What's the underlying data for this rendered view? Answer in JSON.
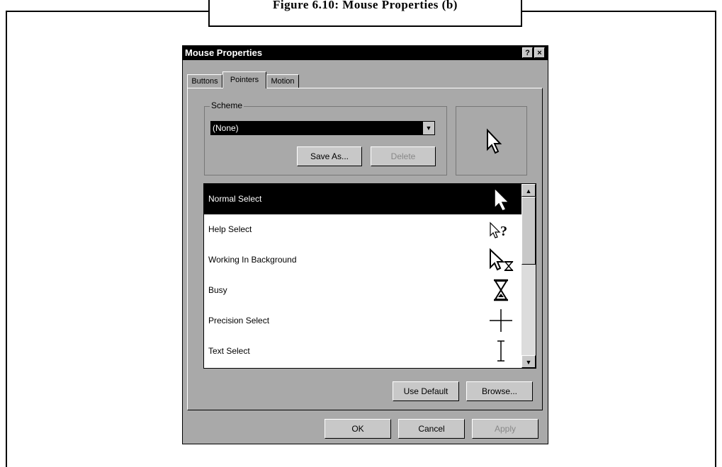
{
  "figure": {
    "caption": "Figure 6.10: Mouse Properties (b)"
  },
  "dialog": {
    "title": "Mouse Properties",
    "help_btn": "?",
    "close_btn": "×",
    "tabs": [
      {
        "label": "Buttons"
      },
      {
        "label": "Pointers"
      },
      {
        "label": "Motion"
      }
    ],
    "scheme": {
      "label": "Scheme",
      "selected": "(None)",
      "save_as": "Save As...",
      "delete": "Delete"
    },
    "pointers": [
      {
        "label": "Normal Select",
        "icon": "arrow-cursor-icon",
        "selected": true
      },
      {
        "label": "Help Select",
        "icon": "help-cursor-icon"
      },
      {
        "label": "Working In Background",
        "icon": "working-cursor-icon"
      },
      {
        "label": "Busy",
        "icon": "hourglass-icon"
      },
      {
        "label": "Precision Select",
        "icon": "crosshair-icon"
      },
      {
        "label": "Text Select",
        "icon": "ibeam-icon"
      }
    ],
    "use_default": "Use Default",
    "browse": "Browse...",
    "ok": "OK",
    "cancel": "Cancel",
    "apply": "Apply"
  }
}
